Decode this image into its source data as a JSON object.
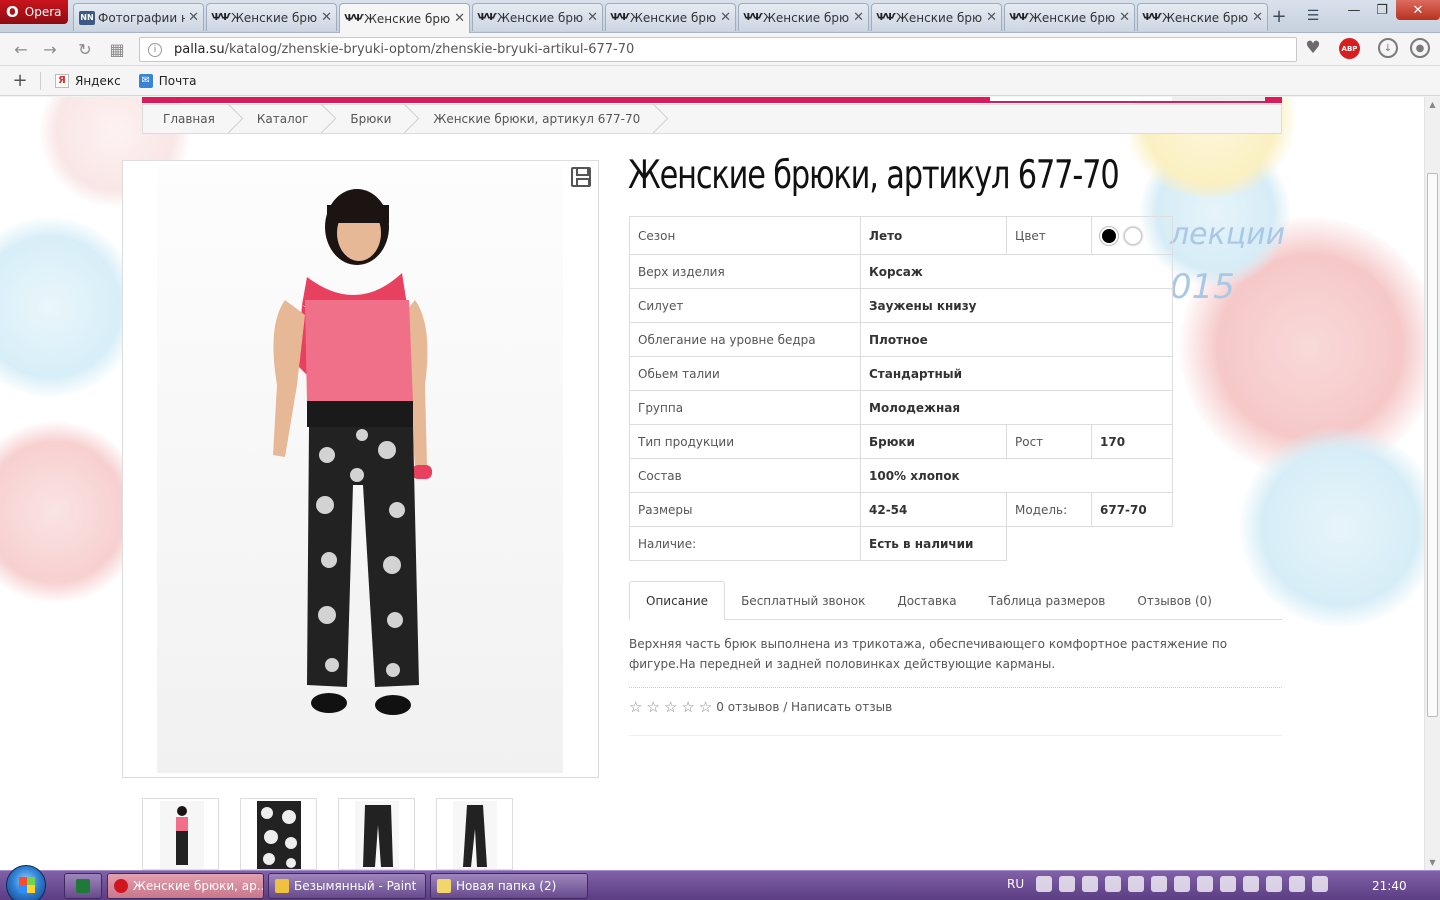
{
  "browser": {
    "menu_label": "Opera",
    "tabs": [
      {
        "title": "Фотографии на"
      },
      {
        "title": "Женские брюки"
      },
      {
        "title": "Женские брюки"
      },
      {
        "title": "Женские брюки"
      },
      {
        "title": "Женские брюки"
      },
      {
        "title": "Женские брюки"
      },
      {
        "title": "Женские брюки"
      },
      {
        "title": "Женские брюки"
      },
      {
        "title": "Женские брюки"
      }
    ],
    "url_domain": "palla.su",
    "url_path": "/katalog/zhenskie-bryuki-optom/zhenskie-bryuki-artikul-677-70",
    "abp_label": "ABP",
    "bookmarks": [
      {
        "label": "Яндекс",
        "icon": "yandex-icon"
      },
      {
        "label": "Почта",
        "icon": "mail-icon"
      }
    ]
  },
  "page": {
    "breadcrumb": [
      "Главная",
      "Каталог",
      "Брюки",
      "Женские брюки, артикул 677-70"
    ],
    "title": "Женские брюки, артикул 677-70",
    "specs": {
      "season_label": "Сезон",
      "season_value": "Лето",
      "color_label": "Цвет",
      "top_label": "Верх изделия",
      "top_value": "Корсаж",
      "silhouette_label": "Силует",
      "silhouette_value": "Заужены книзу",
      "fit_label": "Облегание на уровне бедра",
      "fit_value": "Плотное",
      "waist_label": "Обьем талии",
      "waist_value": "Стандартный",
      "group_label": "Группа",
      "group_value": "Молодежная",
      "type_label": "Тип продукции",
      "type_value": "Брюки",
      "height_label": "Рост",
      "height_value": "170",
      "composition_label": "Состав",
      "composition_value": "100% хлопок",
      "sizes_label": "Размеры",
      "sizes_value": "42-54",
      "model_label": "Модель:",
      "model_value": "677-70",
      "stock_label": "Наличие:",
      "stock_value": "Есть в наличии"
    },
    "colors": [
      "#000000",
      "#ffffff"
    ],
    "tabs": [
      "Описание",
      "Бесплатный звонок",
      "Доставка",
      "Таблица размеров",
      "Отзывов (0)"
    ],
    "description": "Верхняя часть брюк выполнена из трикотажа, обеспечивающего комфортное растяжение по фигуре.На передней и задней половинках действующие карманы.",
    "reviews_text": "0 отзывов / Написать отзыв",
    "bg_text_1": "лекции",
    "bg_text_2": "015"
  },
  "taskbar": {
    "items": [
      {
        "label": "Женские брюки, ар..."
      },
      {
        "label": "Безымянный - Paint"
      },
      {
        "label": "Новая папка (2)"
      }
    ],
    "lang": "RU",
    "time": "21:40"
  },
  "colors": {
    "brand": "#d81b5a",
    "taskbar": "#6a4b94"
  }
}
